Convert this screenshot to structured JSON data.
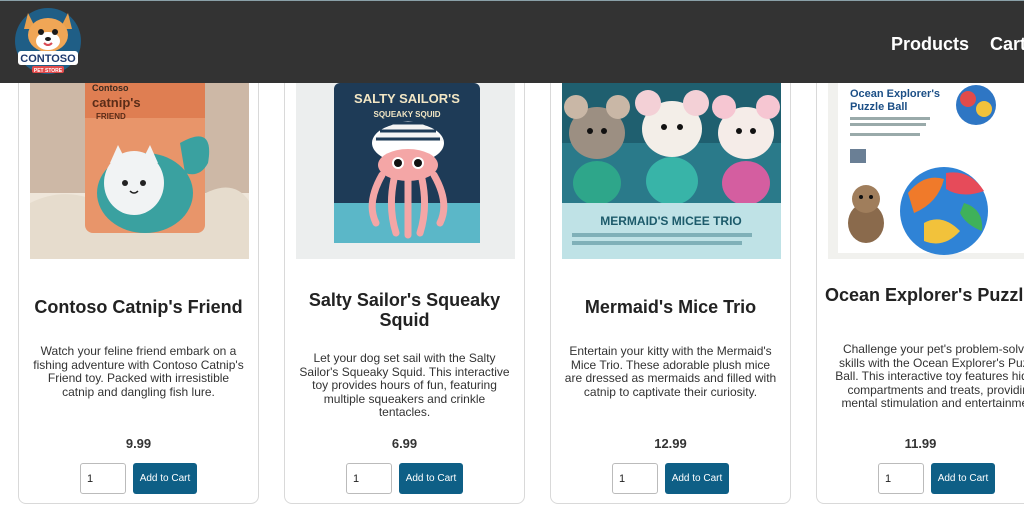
{
  "header": {
    "brand": "CONTOSO",
    "brand_sub": "PET STORE",
    "nav": {
      "products": "Products",
      "cart": "Cart"
    }
  },
  "products": [
    {
      "title": "Contoso Catnip's Friend",
      "description": "Watch your feline friend embark on a fishing adventure with Contoso Catnip's Friend toy. Packed with irresistible catnip and dangling fish lure.",
      "price": "9.99",
      "qty": "1",
      "button": "Add to Cart",
      "package_brand": "Contoso",
      "package_title": "catnip's",
      "package_sub": "FRIEND"
    },
    {
      "title": "Salty Sailor's Squeaky Squid",
      "description": "Let your dog set sail with the Salty Sailor's Squeaky Squid. This interactive toy provides hours of fun, featuring multiple squeakers and crinkle tentacles.",
      "price": "6.99",
      "qty": "1",
      "button": "Add to Cart",
      "package_title": "SALTY SAILOR'S",
      "package_sub": "SQUEAKY SQUID"
    },
    {
      "title": "Mermaid's Mice Trio",
      "description": "Entertain your kitty with the Mermaid's Mice Trio. These adorable plush mice are dressed as mermaids and filled with catnip to captivate their curiosity.",
      "price": "12.99",
      "qty": "1",
      "button": "Add to Cart",
      "package_title": "MERMAID'S MICEE TRIO"
    },
    {
      "title": "Ocean Explorer's Puzzle Ball",
      "description": "Challenge your pet's problem-solving skills with the Ocean Explorer's Puzzle Ball. This interactive toy features hidden compartments and treats, providing mental stimulation and entertainment.",
      "price": "11.99",
      "qty": "1",
      "button": "Add to Cart",
      "package_title": "Ocean Explorer's",
      "package_sub": "Puzzle Ball"
    }
  ],
  "colors": {
    "header_bg": "#333333",
    "button_bg": "#0e5f86",
    "nav_text": "#ffffff"
  }
}
